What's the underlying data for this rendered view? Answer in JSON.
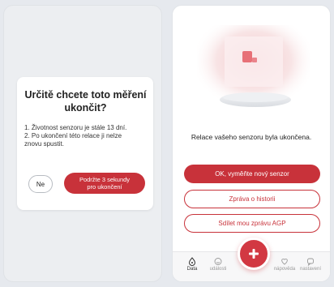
{
  "dialog": {
    "title_line1": "Určitě chcete toto měření",
    "title_line2": "ukončit?",
    "line1": "1. Životnost senzoru je stále 13 dní.",
    "line2a": "2. Po ukončení této relace ji nelze",
    "line2b": "znovu spustit.",
    "no_label": "Ne",
    "hold_label_line1": "Podržte 3 sekundy",
    "hold_label_line2": "pro ukončení"
  },
  "ended": {
    "message": "Relace vašeho senzoru byla ukončena.",
    "replace_label": "OK, vyměňte nový senzor",
    "history_label": "Zpráva o historii",
    "share_label": "Sdílet mou zprávu AGP"
  },
  "nav": {
    "data_label": "Data",
    "events_label": "události",
    "help_label": "nápověda",
    "settings_label": "nastavení"
  },
  "colors": {
    "accent": "#c8323a",
    "fab": "#d23842"
  },
  "icons": {
    "data": "drop-icon",
    "events": "smile-icon",
    "add": "plus-icon",
    "help": "heart-icon",
    "settings": "chat-icon"
  }
}
